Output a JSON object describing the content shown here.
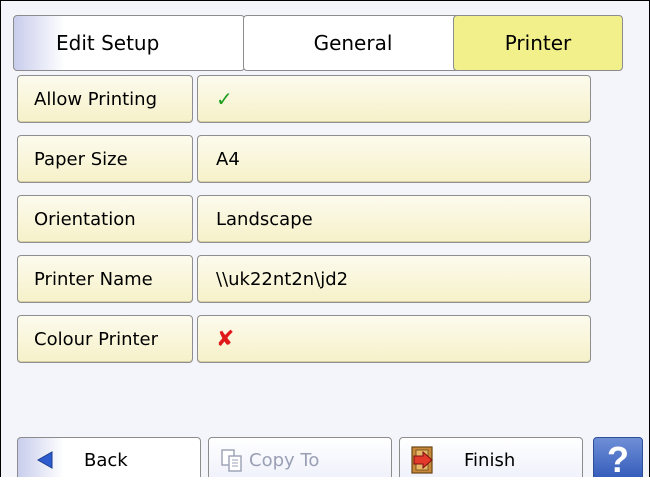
{
  "breadcrumb": [
    "Edit Setup",
    "General",
    "Printer"
  ],
  "rows": [
    {
      "label": "Allow Printing",
      "value": "✓",
      "value_icon": "check-icon"
    },
    {
      "label": "Paper Size",
      "value": "A4"
    },
    {
      "label": "Orientation",
      "value": "Landscape"
    },
    {
      "label": "Printer Name",
      "value": "\\\\uk22nt2n\\jd2"
    },
    {
      "label": "Colour Printer",
      "value": "✘",
      "value_icon": "cross-icon"
    }
  ],
  "buttons": {
    "back": "Back",
    "copy_to": "Copy To",
    "finish": "Finish",
    "help": "?"
  },
  "colors": {
    "active_crumb": "#f2f08a",
    "row_fill": "#f6f1c9",
    "check": "#1e9e1e",
    "cross": "#e01a1a"
  }
}
